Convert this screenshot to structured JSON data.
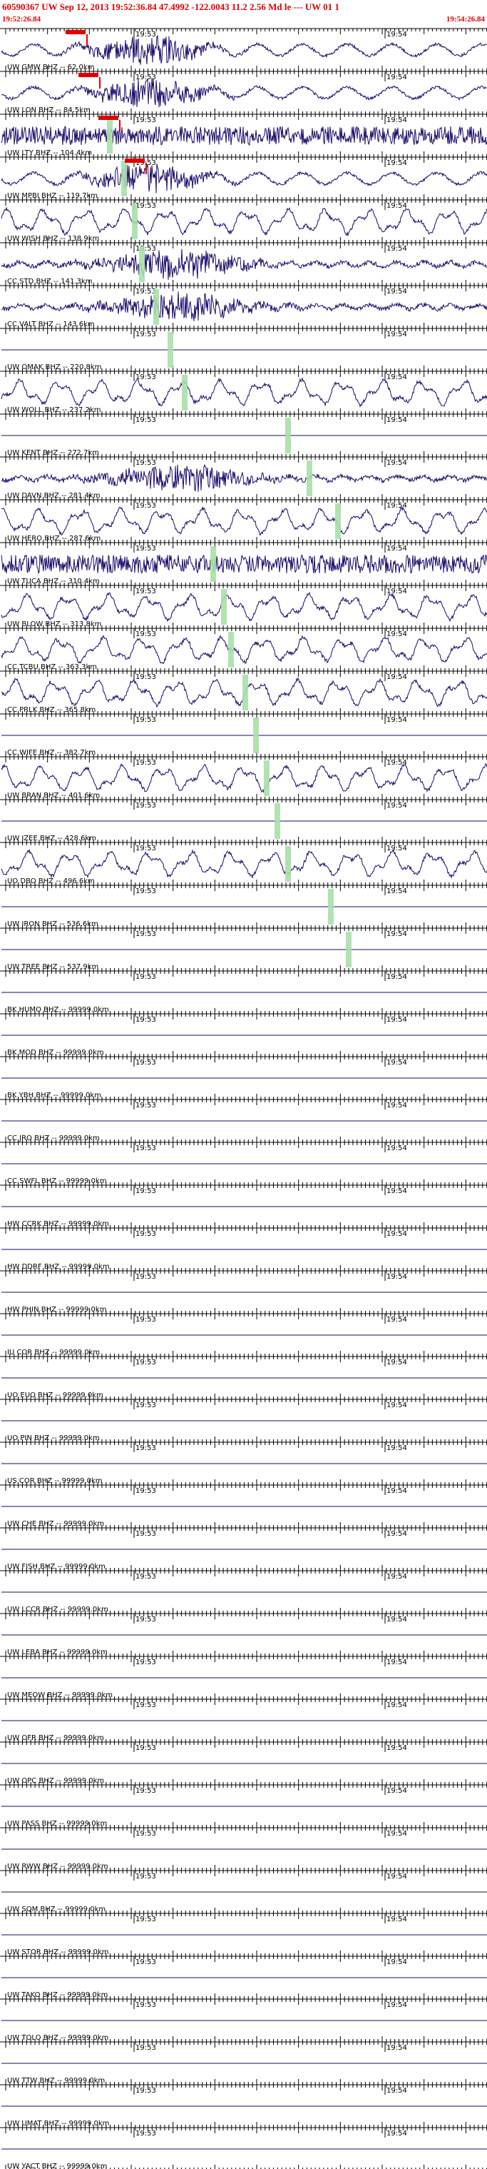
{
  "header": {
    "title": "60590367 UW Sep 12, 2013 19:52:36.84    47.4992  -122.0043  11.2  2.56  Md  le  ---  UW  01    1",
    "start_time": "19:52:26.84",
    "end_time": "19:54:26.84"
  },
  "minute_labels": [
    "19:53",
    "19:54"
  ],
  "colors": {
    "trace": "#1a0a6b",
    "pick_marker": "#e00000",
    "travel_time_bar": "#a8e0a8",
    "header_text": "#e00000"
  },
  "traces": [
    {
      "label": "UW GMW BHZ -- 62.0km",
      "waveform": "local-event"
    },
    {
      "label": "UW LON BHZ -- 84.5km",
      "waveform": "local-event"
    },
    {
      "label": "UW LTY BHZ -- 104.4km",
      "waveform": "noise"
    },
    {
      "label": "UW MPBI BHZ -- 119.7km",
      "waveform": "local-event"
    },
    {
      "label": "UW WISH BHZ -- 138.9km",
      "waveform": "microseism"
    },
    {
      "label": "CC STD BHZ -- 141.3km",
      "waveform": "noise-burst"
    },
    {
      "label": "CC VALT BHZ -- 143.6km",
      "waveform": "noise-burst"
    },
    {
      "label": "UW OMAK BHZ -- 220.8km",
      "waveform": "flat"
    },
    {
      "label": "UW WOLL BHZ -- 237.2km",
      "waveform": "microseism"
    },
    {
      "label": "UW KENT BHZ -- 272.7km",
      "waveform": "flat"
    },
    {
      "label": "UW DAVN BHZ -- 281.4km",
      "waveform": "noise-burst"
    },
    {
      "label": "UW HERO BHZ -- 287.6km",
      "waveform": "microseism"
    },
    {
      "label": "UW TUCA BHZ -- 310.4km",
      "waveform": "noise"
    },
    {
      "label": "UW BLOW BHZ -- 313.8km",
      "waveform": "microseism"
    },
    {
      "label": "CC TCBU BHZ -- 363.3km",
      "waveform": "microseism"
    },
    {
      "label": "CC PRLK BHZ -- 365.8km",
      "waveform": "microseism"
    },
    {
      "label": "CC WIFE BHZ -- 382.7km",
      "waveform": "flat"
    },
    {
      "label": "UW BRAN BHZ -- 401.6km",
      "waveform": "microseism"
    },
    {
      "label": "UW IZEE BHZ -- 428.6km",
      "waveform": "flat"
    },
    {
      "label": "UO DBO BHZ -- 496.6km",
      "waveform": "microseism"
    },
    {
      "label": "UW IRON BHZ -- 536.6km",
      "waveform": "flat"
    },
    {
      "label": "UW TREE BHZ -- 537.9km",
      "waveform": "flat"
    },
    {
      "label": "BK HUMO BHZ -- 99999.0km",
      "waveform": "flat"
    },
    {
      "label": "BK MOD BHZ -- 99999.0km",
      "waveform": "flat"
    },
    {
      "label": "BK YBH BHZ -- 99999.0km",
      "waveform": "flat"
    },
    {
      "label": "CC JRO BHZ -- 99999.0km",
      "waveform": "flat"
    },
    {
      "label": "CC SWFL BHZ -- 99999.0km",
      "waveform": "flat"
    },
    {
      "label": "HW CCRK BHZ -- 99999.0km",
      "waveform": "flat"
    },
    {
      "label": "HW DDRF BHZ -- 99999.0km",
      "waveform": "flat"
    },
    {
      "label": "HW PHIN BHZ -- 99999.0km",
      "waveform": "flat"
    },
    {
      "label": "IU COR BHZ -- 99999.0km",
      "waveform": "flat"
    },
    {
      "label": "UO EUO BHZ -- 99999.0km",
      "waveform": "flat"
    },
    {
      "label": "UO PIN BHZ -- 99999.0km",
      "waveform": "flat"
    },
    {
      "label": "US COR BHZ -- 99999.0km",
      "waveform": "flat"
    },
    {
      "label": "UW CHE BHZ -- 99999.0km",
      "waveform": "flat"
    },
    {
      "label": "UW FISH BHZ -- 99999.0km",
      "waveform": "flat"
    },
    {
      "label": "UW LCCR BHZ -- 99999.0km",
      "waveform": "flat"
    },
    {
      "label": "UW LEBA BHZ -- 99999.0km",
      "waveform": "flat"
    },
    {
      "label": "UW MEOW BHZ -- 99999.0km",
      "waveform": "flat"
    },
    {
      "label": "UW OFR BHZ -- 99999.0km",
      "waveform": "flat"
    },
    {
      "label": "UW OPC BHZ -- 99999.0km",
      "waveform": "flat"
    },
    {
      "label": "UW PASS BHZ -- 99999.0km",
      "waveform": "flat"
    },
    {
      "label": "UW RWW BHZ -- 99999.0km",
      "waveform": "flat"
    },
    {
      "label": "UW SQM BHZ -- 99999.0km",
      "waveform": "flat"
    },
    {
      "label": "UW STOR BHZ -- 99999.0km",
      "waveform": "flat"
    },
    {
      "label": "UW TAKO BHZ -- 99999.0km",
      "waveform": "flat"
    },
    {
      "label": "UW TOLO BHZ -- 99999.0km",
      "waveform": "flat"
    },
    {
      "label": "UW TTW BHZ -- 99999.0km",
      "waveform": "flat"
    },
    {
      "label": "UW UMAT BHZ -- 99999.0km",
      "waveform": "flat"
    },
    {
      "label": "UW YACT BHZ -- 99999.0km",
      "waveform": "flat"
    }
  ]
}
